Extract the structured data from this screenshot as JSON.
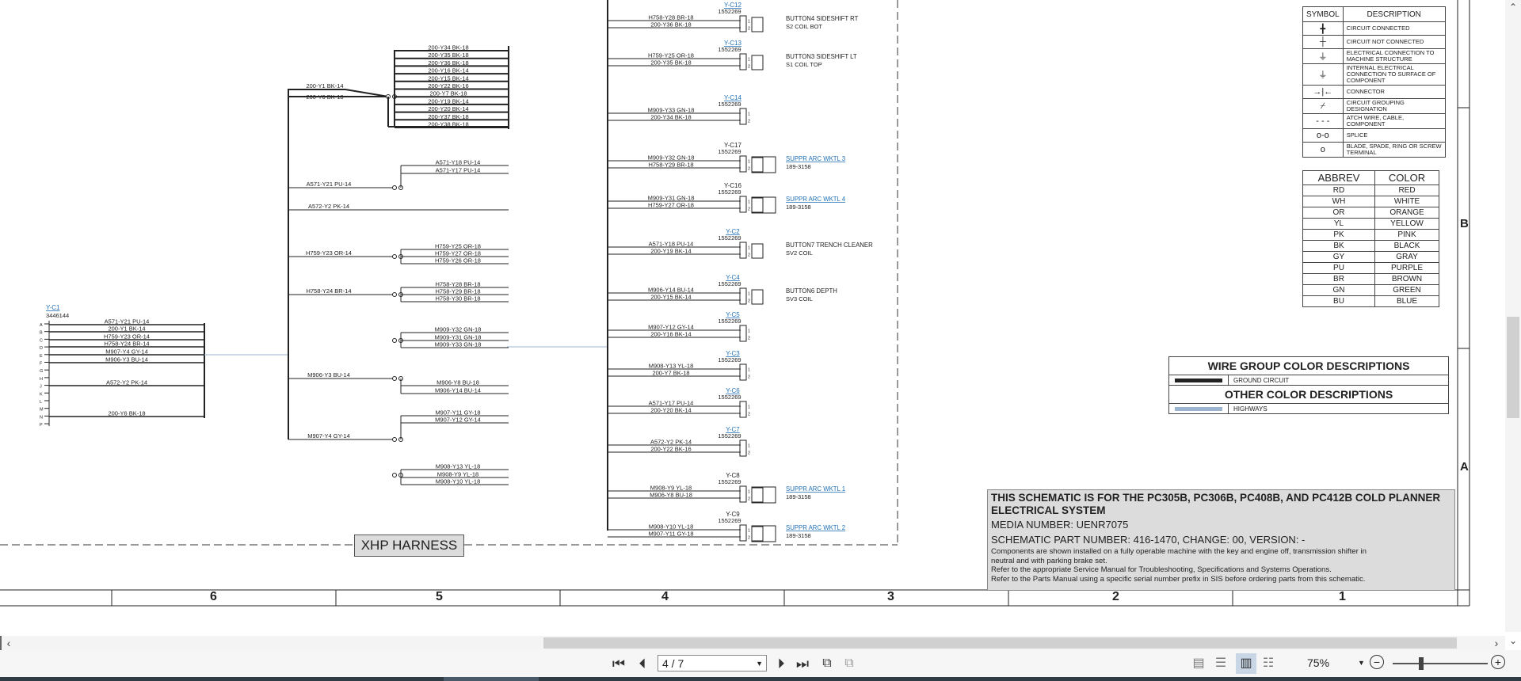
{
  "schematic": {
    "harness_label": "XHP HARNESS",
    "zone_letters": [
      "B",
      "A"
    ],
    "column_numbers": [
      "6",
      "5",
      "4",
      "3",
      "2",
      "1"
    ],
    "main_connector": {
      "id": "Y-C1",
      "part": "3446144",
      "pins": [
        "A",
        "B",
        "C",
        "D",
        "E",
        "F",
        "G",
        "H",
        "J",
        "K",
        "L",
        "M",
        "N",
        "P"
      ],
      "wires": [
        "A571-Y21 PU-14",
        "200-Y1 BK-14",
        "H759-Y23 OR-14",
        "H758-Y24 BR-14",
        "M907-Y4 GY-14",
        "M906-Y3 BU-14",
        "A572-Y2 PK-14",
        "200-Y6 BK-18"
      ]
    },
    "ground_splice": {
      "inputs": [
        "200-Y1 BK-14",
        "200-Y6 BK-18"
      ],
      "outputs": [
        "200-Y34 BK-18",
        "200-Y35 BK-18",
        "200-Y36 BK-18",
        "200-Y16 BK-14",
        "200-Y15 BK-14",
        "200-Y22 BK-16",
        "200-Y7 BK-18",
        "200-Y19 BK-14",
        "200-Y20 BK-14",
        "200-Y37 BK-18",
        "200-Y38 BK-18"
      ]
    },
    "splices": [
      {
        "input": "A571-Y21 PU-14",
        "outputs": [
          "A571-Y18 PU-14",
          "A571-Y17 PU-14"
        ]
      },
      {
        "input": "A572-Y2 PK-14",
        "outputs": []
      },
      {
        "input": "H759-Y23 OR-14",
        "outputs": [
          "H759-Y25 OR-18",
          "H759-Y27 OR-18",
          "H759-Y26 OR-18"
        ]
      },
      {
        "input": "H758-Y24 BR-14",
        "outputs": [
          "H758-Y28 BR-18",
          "H758-Y29 BR-18",
          "H758-Y30 BR-18"
        ]
      },
      {
        "input": "",
        "outputs": [
          "M909-Y32 GN-18",
          "M909-Y31 GN-18",
          "M909-Y33 GN-18"
        ]
      },
      {
        "input": "M906-Y3 BU-14",
        "outputs": [
          "M906-Y8 BU-18",
          "M906-Y14 BU-14"
        ]
      },
      {
        "input": "M907-Y4 GY-14",
        "outputs": [
          "M907-Y11 GY-18",
          "M907-Y12 GY-14"
        ]
      },
      {
        "input": "",
        "outputs": [
          "M908-Y13 YL-18",
          "M908-Y9 YL-18",
          "M908-Y10 YL-18"
        ]
      }
    ],
    "connectors": [
      {
        "id": "Y-C12",
        "part": "1552269",
        "wires": [
          "H758-Y28 BR-18",
          "200-Y36 BK-18"
        ],
        "component": "BUTTON4 SIDESHIFT RT",
        "sub": "S2 COIL BOT",
        "link": true
      },
      {
        "id": "Y-C13",
        "part": "1552269",
        "wires": [
          "H759-Y25 OR-18",
          "200-Y35 BK-18"
        ],
        "component": "BUTTON3 SIDESHIFT LT",
        "sub": "S1 COIL TOP",
        "link": true
      },
      {
        "id": "Y-C14",
        "part": "1552269",
        "wires": [
          "M909-Y33 GN-18",
          "200-Y34 BK-18"
        ],
        "component": "",
        "sub": "",
        "link": true
      },
      {
        "id": "Y-C17",
        "part": "1552269",
        "wires": [
          "M909-Y32 GN-18",
          "H758-Y29 BR-18"
        ],
        "component": "SUPPR ARC WKTL 3",
        "sub": "189-3158",
        "link": false
      },
      {
        "id": "Y-C16",
        "part": "1552269",
        "wires": [
          "M909-Y31 GN-18",
          "H759-Y27 OR-18"
        ],
        "component": "SUPPR ARC WKTL 4",
        "sub": "189-3158",
        "link": false
      },
      {
        "id": "Y-C2",
        "part": "1552269",
        "wires": [
          "A571-Y18 PU-14",
          "200-Y19 BK-14"
        ],
        "component": "BUTTON7 TRENCH CLEANER",
        "sub": "SV2 COIL",
        "link": true
      },
      {
        "id": "Y-C4",
        "part": "1552269",
        "wires": [
          "M906-Y14 BU-14",
          "200-Y15 BK-14"
        ],
        "component": "BUTTON6 DEPTH",
        "sub": "SV3 COIL",
        "link": true
      },
      {
        "id": "Y-C5",
        "part": "1552269",
        "wires": [
          "M907-Y12 GY-14",
          "200-Y16 BK-14"
        ],
        "component": "",
        "sub": "",
        "link": true
      },
      {
        "id": "Y-C3",
        "part": "1552269",
        "wires": [
          "M908-Y13 YL-18",
          "200-Y7 BK-18"
        ],
        "component": "",
        "sub": "",
        "link": true
      },
      {
        "id": "Y-C6",
        "part": "1552269",
        "wires": [
          "A571-Y17 PU-14",
          "200-Y20 BK-14"
        ],
        "component": "",
        "sub": "",
        "link": true
      },
      {
        "id": "Y-C7",
        "part": "1552269",
        "wires": [
          "A572-Y2 PK-14",
          "200-Y22 BK-16"
        ],
        "component": "",
        "sub": "",
        "link": true
      },
      {
        "id": "Y-C8",
        "part": "1552269",
        "wires": [
          "M908-Y9 YL-18",
          "M906-Y8 BU-18"
        ],
        "component": "SUPPR ARC WKTL 1",
        "sub": "189-3158",
        "link": false
      },
      {
        "id": "Y-C9",
        "part": "1552269",
        "wires": [
          "M908-Y10 YL-18",
          "M907-Y11 GY-18"
        ],
        "component": "SUPPR ARC WKTL 2",
        "sub": "189-3158",
        "link": false
      }
    ]
  },
  "symbol_table": {
    "headers": [
      "SYMBOL",
      "DESCRIPTION"
    ],
    "rows": [
      {
        "symbol": "╋",
        "desc": "CIRCUIT CONNECTED"
      },
      {
        "symbol": "┼",
        "desc": "CIRCUIT NOT CONNECTED"
      },
      {
        "symbol": "⏚",
        "desc": "ELECTRICAL CONNECTION TO MACHINE STRUCTURE"
      },
      {
        "symbol": "⏚",
        "desc": "INTERNAL ELECTRICAL CONNECTION TO SURFACE OF COMPONENT"
      },
      {
        "symbol": "→|←",
        "desc": "CONNECTOR"
      },
      {
        "symbol": "⌿",
        "desc": "CIRCUIT GROUPING DESIGNATION"
      },
      {
        "symbol": "- - -",
        "desc": "ATCH WIRE, CABLE, COMPONENT"
      },
      {
        "symbol": "o-o",
        "desc": "SPLICE"
      },
      {
        "symbol": "o",
        "desc": "BLADE, SPADE, RING OR SCREW TERMINAL"
      }
    ]
  },
  "abbrev_table": {
    "headers": [
      "ABBREV",
      "COLOR"
    ],
    "rows": [
      [
        "RD",
        "RED"
      ],
      [
        "WH",
        "WHITE"
      ],
      [
        "OR",
        "ORANGE"
      ],
      [
        "YL",
        "YELLOW"
      ],
      [
        "PK",
        "PINK"
      ],
      [
        "BK",
        "BLACK"
      ],
      [
        "GY",
        "GRAY"
      ],
      [
        "PU",
        "PURPLE"
      ],
      [
        "BR",
        "BROWN"
      ],
      [
        "GN",
        "GREEN"
      ],
      [
        "BU",
        "BLUE"
      ]
    ]
  },
  "wire_group": {
    "title": "WIRE GROUP COLOR DESCRIPTIONS",
    "ground_label": "GROUND CIRCUIT",
    "ground_color": "#222222",
    "other_title": "OTHER COLOR DESCRIPTIONS",
    "highways_label": "HIGHWAYS",
    "highways_color": "#9bb5d1"
  },
  "title_block": {
    "title": "THIS SCHEMATIC IS FOR THE PC305B, PC306B, PC408B, AND PC412B COLD PLANNER ELECTRICAL SYSTEM",
    "media": "MEDIA NUMBER: UENR7075",
    "part": "SCHEMATIC PART NUMBER: 416-1470, CHANGE: 00, VERSION: -",
    "note1": "Components are shown installed on a fully operable machine with the key and engine off, transmission shifter in neutral and with parking brake set.",
    "note2": "Refer to the appropriate Service Manual for Troubleshooting, Specifications and Systems Operations.",
    "note3": "Refer to the Parts Manual using a specific serial number prefix in SIS before ordering parts from this schematic."
  },
  "viewer": {
    "page_value": "4 / 7",
    "zoom_value": "75%",
    "zoom_fraction": 0.3,
    "icons": [
      "first-page-icon",
      "prev-page-icon",
      "next-page-icon",
      "last-page-icon",
      "go-back-icon",
      "go-forward-icon",
      "single-page-icon",
      "continuous-icon",
      "two-page-icon",
      "two-page-scroll-icon",
      "zoom-out-icon",
      "zoom-in-icon"
    ]
  }
}
